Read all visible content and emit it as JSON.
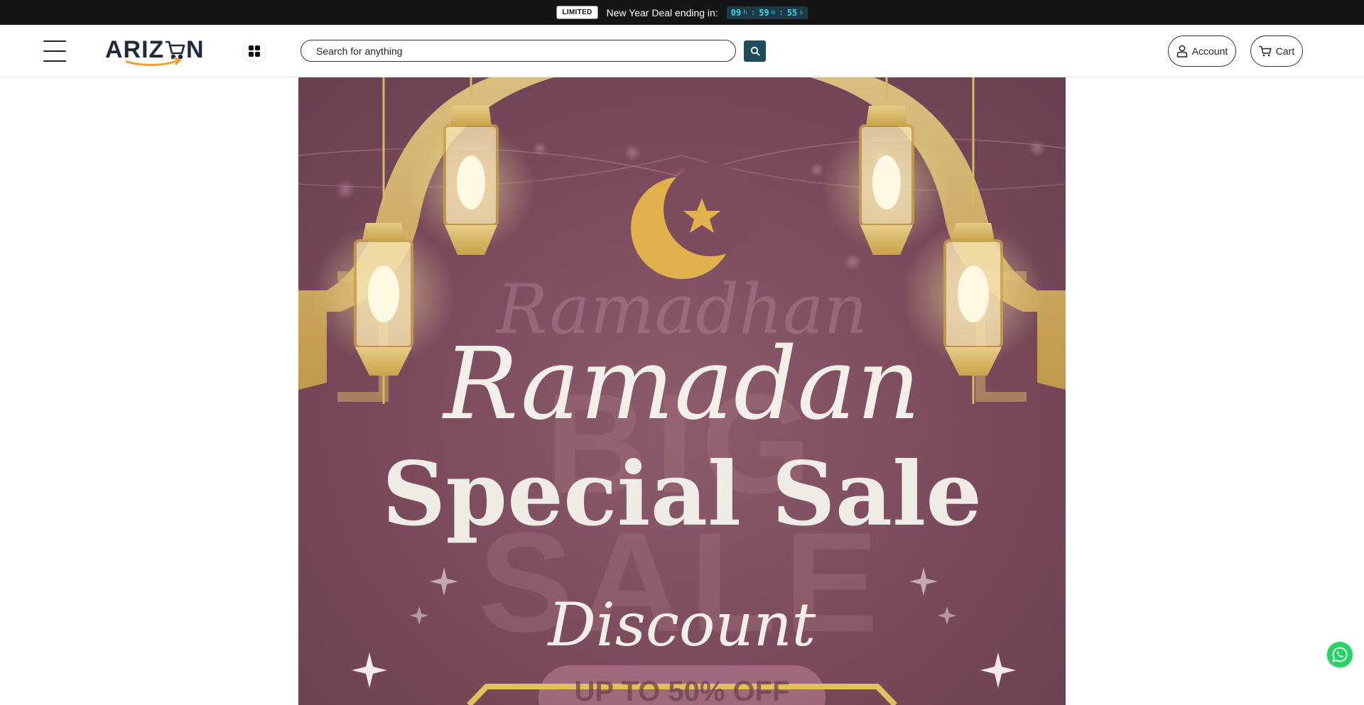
{
  "promo": {
    "badge": "LIMITED",
    "text": "New Year Deal ending in:",
    "countdown": {
      "hours": "09",
      "hours_unit": "h",
      "minutes": "59",
      "minutes_unit": "m",
      "seconds": "55",
      "seconds_unit": "s"
    }
  },
  "header": {
    "logo_text": "ARIZ N",
    "search_placeholder": "Search for anything",
    "account_label": "Account",
    "cart_label": "Cart"
  },
  "banner": {
    "script_word": "Ramadan",
    "ghost_word": "Ramadhan",
    "headline": "Special Sale",
    "ghost_big": "BIG",
    "ghost_sale": "SALE",
    "sub": "Discount",
    "offer": "UP TO 50% OFF"
  },
  "colors": {
    "promo_bg": "#141414",
    "countdown_text": "#45d6e6",
    "search_button": "#1b4e58",
    "banner_bg": "#7a4a5c",
    "gold": "#d7b35a",
    "whatsapp": "#25d366"
  },
  "icons": {
    "menu": "hamburger-icon",
    "apps": "grid-icon",
    "search": "search-icon",
    "account": "user-icon",
    "cart": "cart-icon",
    "chat": "whatsapp-icon"
  }
}
